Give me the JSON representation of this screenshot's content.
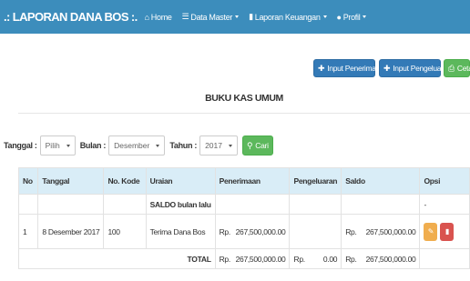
{
  "navbar": {
    "brand": ".: LAPORAN DANA BOS :.",
    "items": [
      {
        "label": "Home",
        "icon": "home-icon",
        "dropdown": false
      },
      {
        "label": "Data Master",
        "icon": "list-icon",
        "dropdown": true
      },
      {
        "label": "Laporan Keuangan",
        "icon": "document-icon",
        "dropdown": true
      },
      {
        "label": "Profil",
        "icon": "user-icon",
        "dropdown": true
      }
    ],
    "color": "#3c8dbc"
  },
  "actions": {
    "input_penerimaan": "Input Penerimaan",
    "input_pengeluaran": "Input Pengeluaran",
    "cetak": "Cetak"
  },
  "page_title": "BUKU KAS UMUM",
  "filter": {
    "tanggal_label": "Tanggal :",
    "tanggal_value": "Pilih",
    "bulan_label": "Bulan :",
    "bulan_value": "Desember",
    "tahun_label": "Tahun :",
    "tahun_value": "2017",
    "cari_label": "Cari"
  },
  "table": {
    "headers": [
      "No",
      "Tanggal",
      "No. Kode",
      "Uraian",
      "Penerimaan",
      "Pengeluaran",
      "Saldo",
      "Opsi"
    ],
    "saldo_row": {
      "uraian": "SALDO bulan lalu",
      "opsi": "-"
    },
    "rows": [
      {
        "no": "1",
        "tanggal": "8 Desember 2017",
        "kode": "100",
        "uraian": "Terima Dana Bos",
        "penerimaan_cur": "Rp.",
        "penerimaan": "267,500,000.00",
        "saldo_cur": "Rp.",
        "saldo": "267,500,000.00"
      }
    ],
    "total": {
      "label": "TOTAL",
      "penerimaan_cur": "Rp.",
      "penerimaan": "267,500,000.00",
      "pengeluaran_cur": "Rp.",
      "pengeluaran": "0.00",
      "saldo_cur": "Rp.",
      "saldo": "267,500,000.00"
    }
  }
}
